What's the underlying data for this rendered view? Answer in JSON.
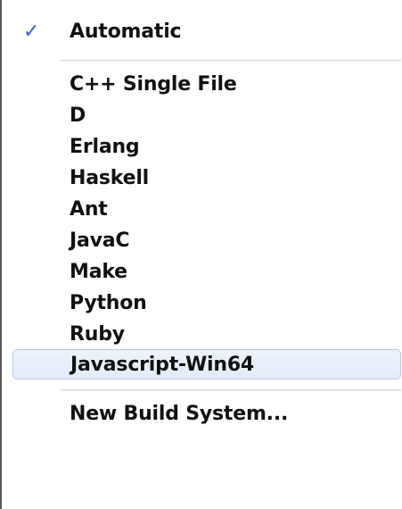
{
  "menu": {
    "top": {
      "label": "Automatic",
      "checked": true,
      "check_glyph": "✓"
    },
    "items": [
      {
        "label": "C++ Single File"
      },
      {
        "label": "D"
      },
      {
        "label": "Erlang"
      },
      {
        "label": "Haskell"
      },
      {
        "label": "Ant"
      },
      {
        "label": "JavaC"
      },
      {
        "label": "Make"
      },
      {
        "label": "Python"
      },
      {
        "label": "Ruby"
      },
      {
        "label": "Javascript-Win64",
        "highlighted": true
      }
    ],
    "bottom": {
      "label": "New Build System..."
    },
    "colors": {
      "check": "#3a5fc8",
      "highlight_bg": "#e8eef9",
      "highlight_border": "#b9cde8",
      "text": "#111111"
    }
  }
}
